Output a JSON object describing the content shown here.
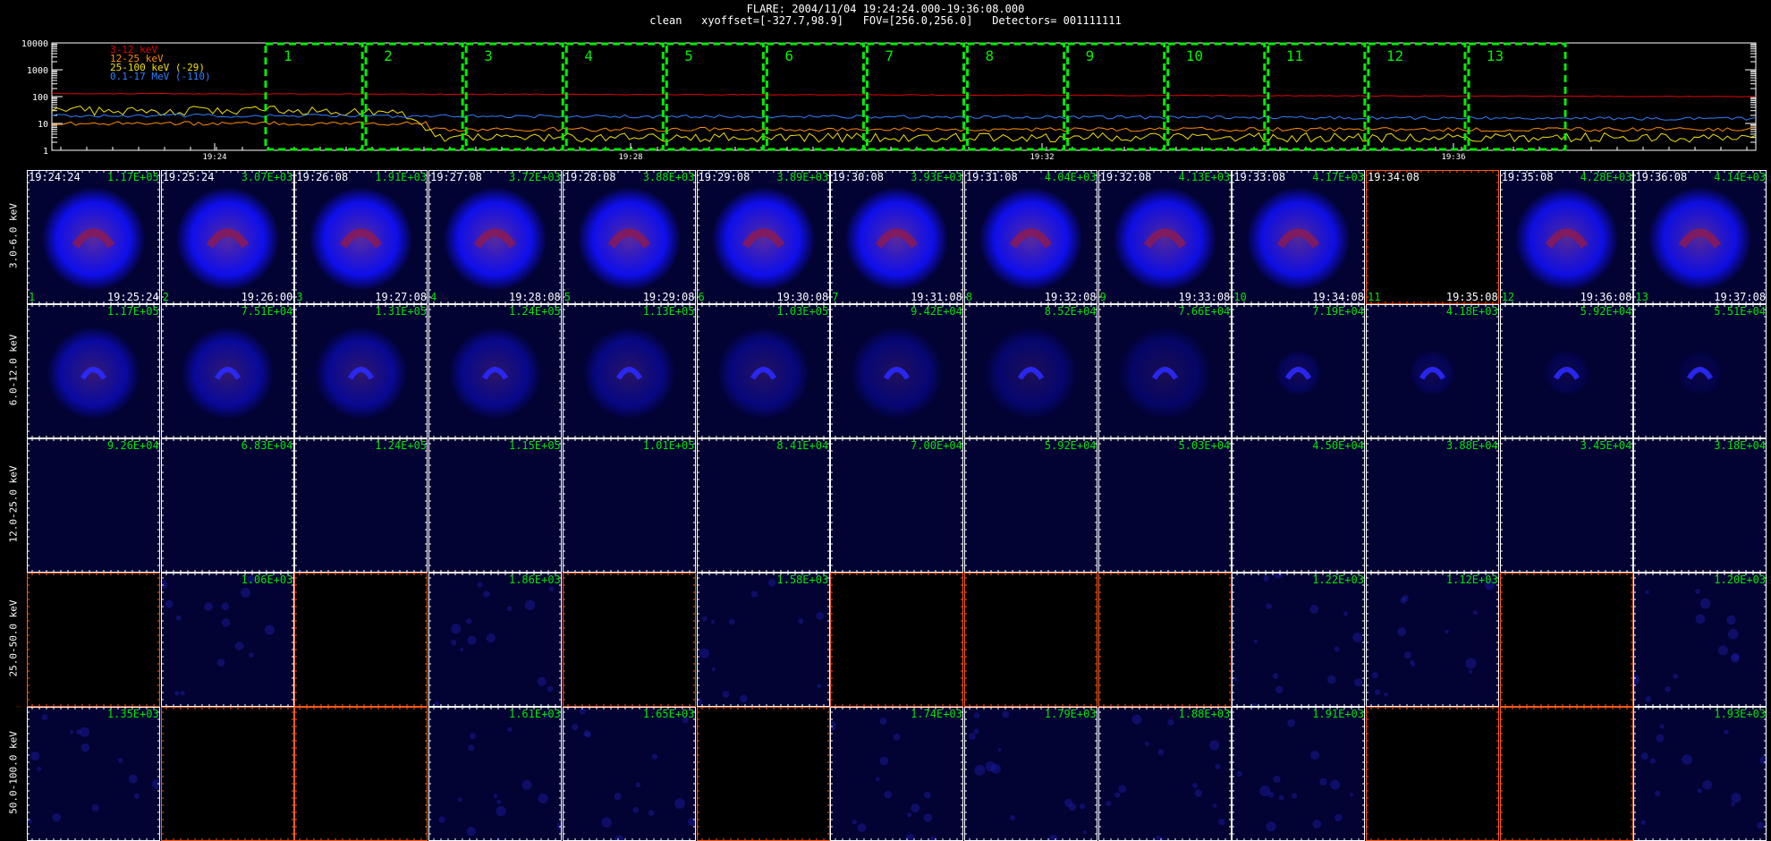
{
  "header": {
    "line1": "FLARE: 2004/11/04 19:24:24.000-19:36:08.000",
    "line2": "clean   xyoffset=[-327.7,98.9]   FOV=[256.0,256.0]   Detectors= 001111111"
  },
  "chart_data": [
    {
      "type": "line",
      "yscale": "log",
      "ylim": [
        1,
        10000
      ],
      "ytick_labels": [
        "10000",
        "1000",
        "100",
        "10",
        "1"
      ],
      "xtick_labels": [
        "19:24",
        "19:28",
        "19:32",
        "19:36"
      ],
      "legend": [
        {
          "label": "3-12 keV",
          "color": "#e00000"
        },
        {
          "label": "12-25 keV",
          "color": "#ff8c00"
        },
        {
          "label": "25-100 keV (-29)",
          "color": "#f0e000"
        },
        {
          "label": "0.1-17 MeV (-110)",
          "color": "#2f7fff"
        }
      ],
      "interval_labels": [
        "1",
        "2",
        "3",
        "4",
        "5",
        "6",
        "7",
        "8",
        "9",
        "10",
        "11",
        "12",
        "13"
      ],
      "interval_color": "#00ee00",
      "series": [
        {
          "name": "3-12 keV",
          "color": "#e00000",
          "level": 130,
          "level_end": 100,
          "noise": 0.03
        },
        {
          "name": "12-25 keV",
          "color": "#ff8c00",
          "level": 10,
          "level_end": 6,
          "noise": 0.15
        },
        {
          "name": "25-100 keV (-29)",
          "color": "#f0e000",
          "level": 30,
          "level_end": 3,
          "noise": 0.35
        },
        {
          "name": "0.1-17 MeV (-110)",
          "color": "#2f7fff",
          "level": 20,
          "level_end": 15,
          "noise": 0.12
        }
      ]
    },
    {
      "type": "heatmap",
      "row_labels": [
        "3.0-6.0 keV",
        "6.0-12.0 keV",
        "12.0-25.0 keV",
        "25.0-50.0 keV",
        "50.0-100.0 keV"
      ],
      "start_times": [
        "19:24:24",
        "19:25:24",
        "19:26:08",
        "19:27:08",
        "19:28:08",
        "19:29:08",
        "19:30:08",
        "19:31:08",
        "19:32:08",
        "19:33:08",
        "19:34:08",
        "19:35:08",
        "19:36:08"
      ],
      "end_times": [
        "19:25:24",
        "19:26:00",
        "19:27:08",
        "19:28:08",
        "19:29:08",
        "19:30:08",
        "19:31:08",
        "19:32:08",
        "19:33:08",
        "19:34:08",
        "19:35:08",
        "19:36:08",
        "19:37:08"
      ],
      "interval_numbers": [
        "1",
        "2",
        "3",
        "4",
        "5",
        "6",
        "7",
        "8",
        "9",
        "10",
        "11",
        "12",
        "13"
      ],
      "peaks": [
        [
          "1.17E+05",
          "3.07E+03",
          "1.91E+03",
          "3.72E+03",
          "3.88E+03",
          "3.89E+03",
          "3.93E+03",
          "4.04E+03",
          "4.13E+03",
          "4.17E+03",
          "",
          "4.28E+03",
          "4.14E+03"
        ],
        [
          "1.17E+05",
          "7.51E+04",
          "1.31E+05",
          "1.24E+05",
          "1.13E+05",
          "1.03E+05",
          "9.42E+04",
          "8.52E+04",
          "7.66E+04",
          "7.19E+04",
          "4.18E+03",
          "5.92E+04",
          "5.51E+04"
        ],
        [
          "9.26E+04",
          "6.83E+04",
          "1.24E+05",
          "1.15E+05",
          "1.01E+05",
          "8.41E+04",
          "7.00E+04",
          "5.92E+04",
          "5.03E+04",
          "4.50E+04",
          "3.88E+04",
          "3.45E+04",
          "3.18E+04"
        ],
        [
          "",
          "1.06E+03",
          "",
          "1.86E+03",
          "",
          "1.58E+03",
          "",
          "",
          "",
          "1.22E+03",
          "1.12E+03",
          "",
          "1.20E+03"
        ],
        [
          "1.35E+03",
          "",
          "",
          "1.61E+03",
          "1.65E+03",
          "",
          "1.74E+03",
          "1.79E+03",
          "1.88E+03",
          "1.91E+03",
          "",
          "",
          "1.93E+03"
        ]
      ],
      "blank_cells": [
        [
          0,
          10
        ],
        [
          3,
          0
        ],
        [
          3,
          2
        ],
        [
          3,
          4
        ],
        [
          3,
          6
        ],
        [
          3,
          7
        ],
        [
          3,
          8
        ],
        [
          3,
          11
        ],
        [
          4,
          1
        ],
        [
          4,
          2
        ],
        [
          4,
          5
        ],
        [
          4,
          10
        ],
        [
          4,
          11
        ]
      ],
      "image_colors": {
        "disk": "#1010ff",
        "core": "#8b1a55",
        "background": "#020233"
      }
    }
  ]
}
